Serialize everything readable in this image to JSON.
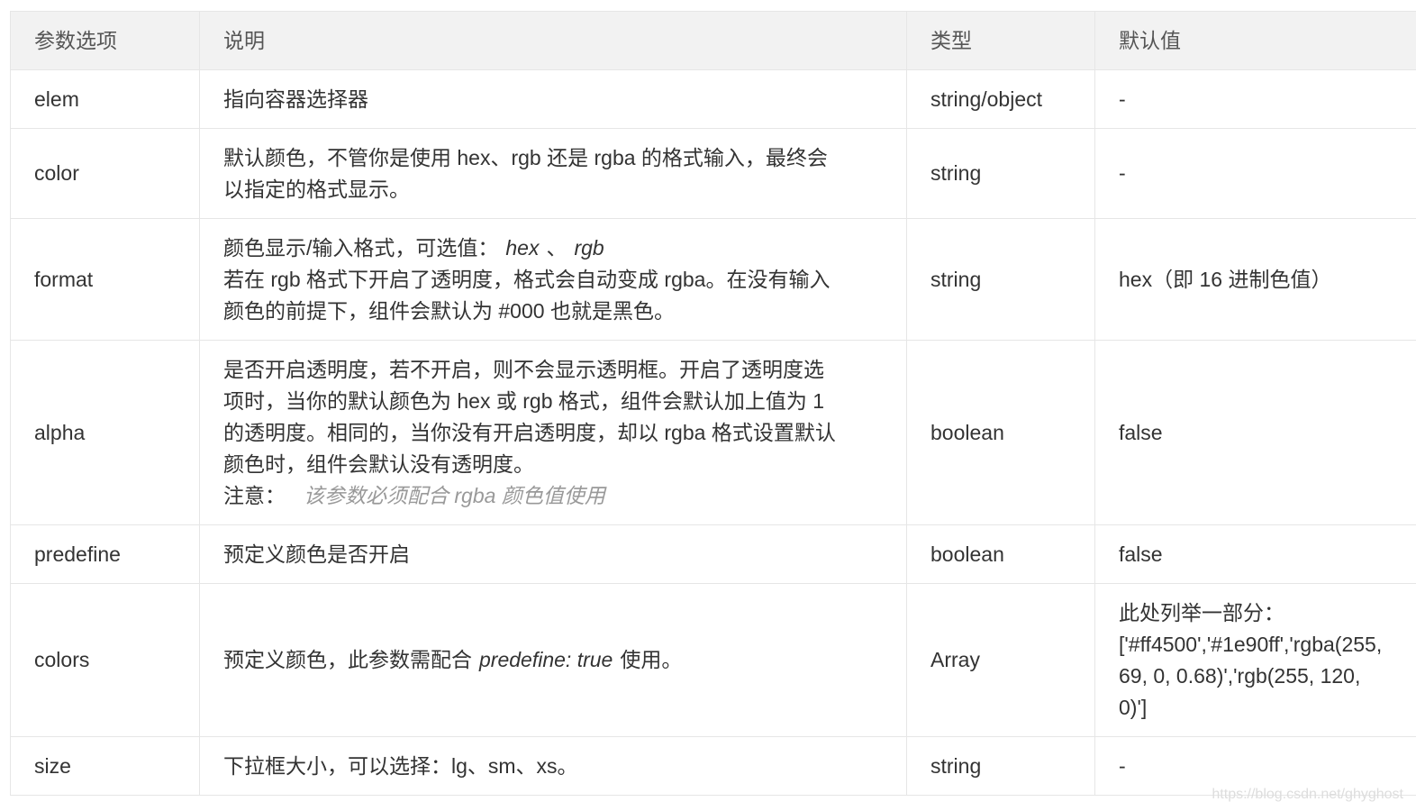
{
  "header": {
    "col1": "参数选项",
    "col2": "说明",
    "col3": "类型",
    "col4": "默认值"
  },
  "rows": {
    "elem": {
      "name": "elem",
      "desc": "指向容器选择器",
      "type": "string/object",
      "default": "-"
    },
    "color": {
      "name": "color",
      "desc_line1": "默认颜色，不管你是使用 hex、rgb 还是 rgba 的格式输入，最终会",
      "desc_line2": "以指定的格式显示。",
      "type": "string",
      "default": "-"
    },
    "format": {
      "name": "format",
      "desc_prefix": "颜色显示/输入格式，可选值：",
      "opt1": "hex",
      "sep": "、",
      "opt2": "rgb",
      "desc_line2": "若在 rgb 格式下开启了透明度，格式会自动变成 rgba。在没有输入",
      "desc_line3": "颜色的前提下，组件会默认为 #000 也就是黑色。",
      "type": "string",
      "default": "hex（即 16 进制色值）"
    },
    "alpha": {
      "name": "alpha",
      "desc_line1": "是否开启透明度，若不开启，则不会显示透明框。开启了透明度选",
      "desc_line2": "项时，当你的默认颜色为 hex 或 rgb 格式，组件会默认加上值为 1",
      "desc_line3": "的透明度。相同的，当你没有开启透明度，却以 rgba 格式设置默认",
      "desc_line4": "颜色时，组件会默认没有透明度。",
      "note_label": "注意：",
      "note_text": "该参数必须配合 rgba 颜色值使用",
      "type": "boolean",
      "default": "false"
    },
    "predefine": {
      "name": "predefine",
      "desc": "预定义颜色是否开启",
      "type": "boolean",
      "default": "false"
    },
    "colors": {
      "name": "colors",
      "desc_prefix": "预定义颜色，此参数需配合",
      "desc_code": "predefine: true",
      "desc_suffix": "使用。",
      "type": "Array",
      "default_line1": "此处列举一部分：",
      "default_line2": "['#ff4500','#1e90ff','rgba(255,",
      "default_line3": "69, 0, 0.68)','rgb(255, 120,",
      "default_line4": "0)']"
    },
    "size": {
      "name": "size",
      "desc": "下拉框大小，可以选择：lg、sm、xs。",
      "type": "string",
      "default": "-"
    }
  },
  "watermark": "https://blog.csdn.net/ghyghost"
}
